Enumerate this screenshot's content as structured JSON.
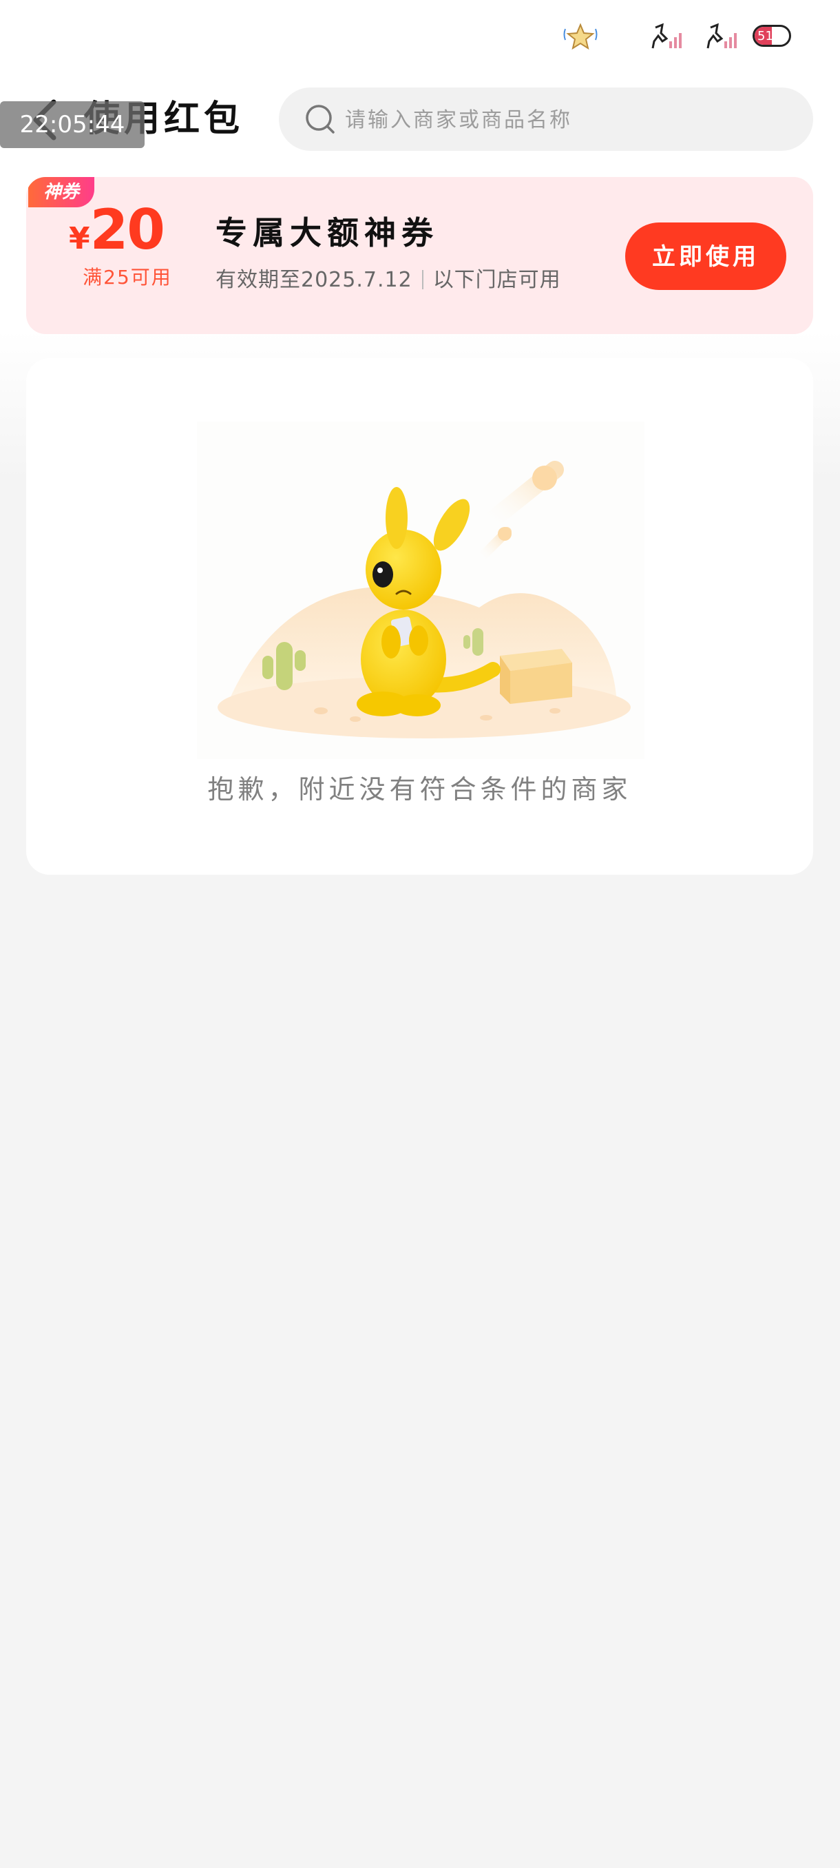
{
  "status_bar": {
    "time": "22:05:44",
    "battery_level": "51"
  },
  "header": {
    "title": "使用红包",
    "search_placeholder": "请输入商家或商品名称"
  },
  "coupon": {
    "tag": "神券",
    "currency": "¥",
    "amount": "20",
    "threshold": "满25可用",
    "name": "专属大额神券",
    "validity": "有效期至2025.7.12",
    "scope": "以下门店可用",
    "button_label": "立即使用",
    "accent_color": "#ff3a21"
  },
  "empty_state": {
    "message": "抱歉，附近没有符合条件的商家",
    "illustration": "yellow-kangaroo-desert-icon"
  }
}
